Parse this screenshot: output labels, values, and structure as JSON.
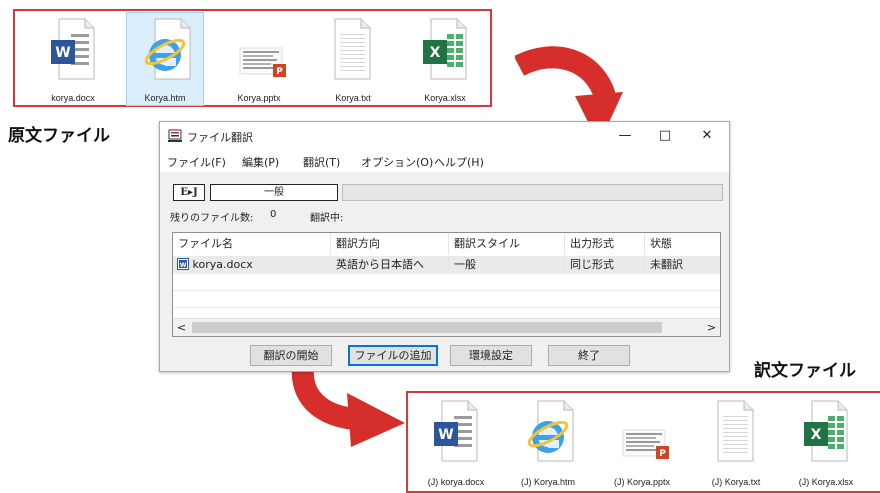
{
  "labels": {
    "source": "原文ファイル",
    "target": "訳文ファイル"
  },
  "source_files": [
    {
      "name": "korya.docx",
      "icon": "word-doc-icon"
    },
    {
      "name": "Korya.htm",
      "icon": "ie-html-icon"
    },
    {
      "name": "Korya.pptx",
      "icon": "powerpoint-doc-icon"
    },
    {
      "name": "Korya.txt",
      "icon": "text-doc-icon"
    },
    {
      "name": "Korya.xlsx",
      "icon": "excel-doc-icon"
    }
  ],
  "target_files": [
    {
      "name": "(J) korya.docx",
      "icon": "word-doc-icon"
    },
    {
      "name": "(J) Korya.htm",
      "icon": "ie-html-icon"
    },
    {
      "name": "(J) Korya.pptx",
      "icon": "powerpoint-doc-icon"
    },
    {
      "name": "(J) Korya.txt",
      "icon": "text-doc-icon"
    },
    {
      "name": "(J) Korya.xlsx",
      "icon": "excel-doc-icon"
    }
  ],
  "window": {
    "title": "ファイル翻訳",
    "controls": {
      "minimize": "—",
      "maximize": "□",
      "close": "✕"
    },
    "menu": [
      "ファイル(F)",
      "編集(P)",
      "翻訳(T)",
      "オプション(O)",
      "ヘルプ(H)"
    ],
    "direction_badge": "E▸J",
    "style_value": "一般",
    "remaining_label": "残りのファイル数:",
    "remaining_count": "0",
    "translating_label": "翻訳中:",
    "columns": [
      "ファイル名",
      "翻訳方向",
      "翻訳スタイル",
      "出力形式",
      "状態"
    ],
    "rows": [
      {
        "file": "korya.docx",
        "direction": "英語から日本語へ",
        "style": "一般",
        "format": "同じ形式",
        "status": "未翻訳"
      }
    ],
    "scroll": {
      "left": "<",
      "right": ">"
    },
    "buttons": {
      "start": "翻訳の開始",
      "add": "ファイルの追加",
      "settings": "環境設定",
      "exit": "終了"
    }
  },
  "colors": {
    "box_border": "#d43a3a",
    "arrow": "#d62e2a",
    "selection": "#dbeefb",
    "focus_button": "#0078d7"
  }
}
